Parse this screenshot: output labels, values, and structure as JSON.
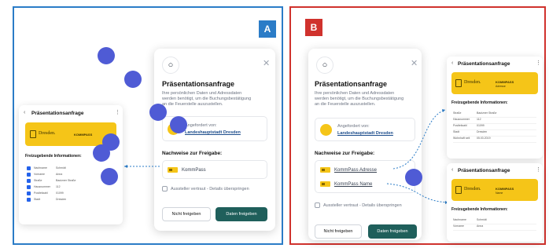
{
  "panelA": {
    "label": "A",
    "dialog": {
      "title": "Präsentationsanfrage",
      "desc1": "Ihre persönlichen Daten und Adressdaten",
      "desc2": "werden benötigt, um die Buchungsbestätigung",
      "desc3": "an die Feuerstelle auszustellen.",
      "req_by": "Angefordert von:",
      "req_name": "Landeshauptstadt Dresden",
      "section": "Nachweise zur Freigabe:",
      "proof": "KommPass",
      "checkbox": "Aussteller vertraut - Details überspringen",
      "btn_cancel": "Nicht freigeben",
      "btn_share": "Daten freigeben"
    },
    "phone": {
      "title": "Präsentationsanfrage",
      "card_city": "Dresden.",
      "card_product": "KOMMPASS",
      "shared": "Freizugebende Informationen:",
      "rows": [
        {
          "k": "Nachname",
          "v": "Schmidt"
        },
        {
          "k": "Vorname",
          "v": "Anna"
        },
        {
          "k": "Straße",
          "v": "Bautzner Straße"
        },
        {
          "k": "Hausnummer",
          "v": "112"
        },
        {
          "k": "Postleitzahl",
          "v": "01099"
        },
        {
          "k": "Stadt",
          "v": "Dresden"
        }
      ]
    }
  },
  "panelB": {
    "label": "B",
    "dialog": {
      "title": "Präsentationsanfrage",
      "desc1": "Ihre persönlichen Daten und Adressdaten",
      "desc2": "werden benötigt, um die Buchungsbestätigung",
      "desc3": "an die Feuerstelle auszustellen.",
      "req_by": "Angefordert von:",
      "req_name": "Landeshauptstadt Dresden",
      "section": "Nachweise zur Freigabe:",
      "proof1": "KommPass Adresse",
      "proof2": "KommPass Name",
      "checkbox": "Aussteller vertraut - Details überspringen",
      "btn_cancel": "Nicht freigeben",
      "btn_share": "Daten freigeben"
    },
    "phone1": {
      "title": "Präsentationsanfrage",
      "card_city": "Dresden.",
      "card_product": "KOMMPASS",
      "card_sub": "Adresse",
      "shared": "Freizugebende Informationen:",
      "rows": [
        {
          "k": "Straße",
          "v": "Bautzner Straße"
        },
        {
          "k": "Hausnummer",
          "v": "112"
        },
        {
          "k": "Postleitzahl",
          "v": "01099"
        },
        {
          "k": "Stadt",
          "v": "Dresden"
        },
        {
          "k": "Wohnhaft seit",
          "v": "05.03.2019"
        }
      ]
    },
    "phone2": {
      "title": "Präsentationsanfrage",
      "card_city": "Dresden.",
      "card_product": "KOMMPASS",
      "card_sub": "Name",
      "shared": "Freizugebende Informationen:",
      "rows": [
        {
          "k": "Nachname",
          "v": "Schmidt"
        },
        {
          "k": "Vorname",
          "v": "Anna"
        }
      ]
    }
  },
  "colors": {
    "blue_frame": "#2b7cc7",
    "red_frame": "#d0322d",
    "accent": "#1f5f5b",
    "card": "#f5c518",
    "dot": "#4f5bd5"
  }
}
